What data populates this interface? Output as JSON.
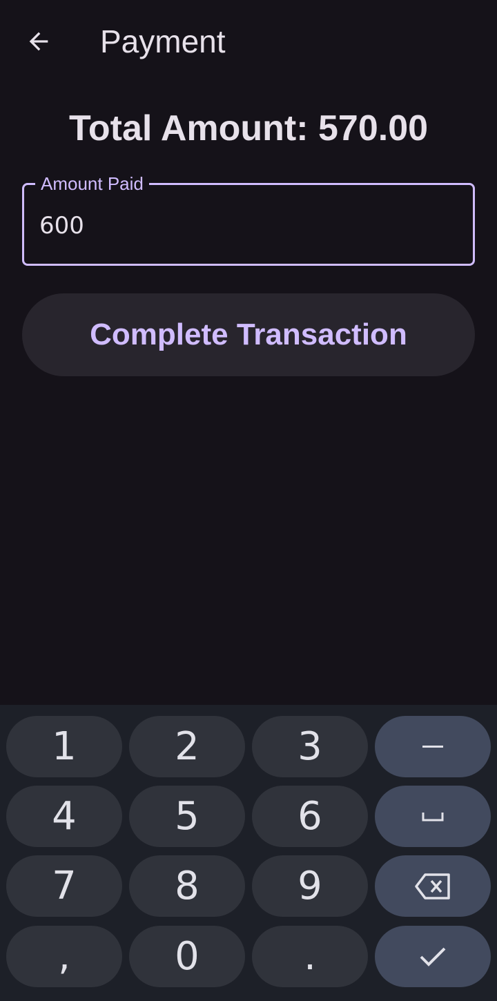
{
  "header": {
    "title": "Payment",
    "back_icon": "arrow-back-icon"
  },
  "total": {
    "text": "Total Amount: 570.00"
  },
  "amount_field": {
    "label": "Amount Paid",
    "value": "600"
  },
  "complete_button": {
    "label": "Complete Transaction"
  },
  "keyboard": {
    "keys": {
      "k1": "1",
      "k2": "2",
      "k3": "3",
      "k4": "4",
      "k5": "5",
      "k6": "6",
      "k7": "7",
      "k8": "8",
      "k9": "9",
      "comma": ",",
      "k0": "0",
      "period": "."
    },
    "icons": {
      "minus": "minus-icon",
      "space": "space-icon",
      "backspace": "backspace-icon",
      "done": "check-icon"
    }
  },
  "colors": {
    "background": "#151219",
    "accent": "#d0bcff",
    "button_bg": "#28252d",
    "key_bg": "#30333b",
    "key_fn_bg": "#424a5e",
    "keyboard_bg": "#1d2028"
  }
}
